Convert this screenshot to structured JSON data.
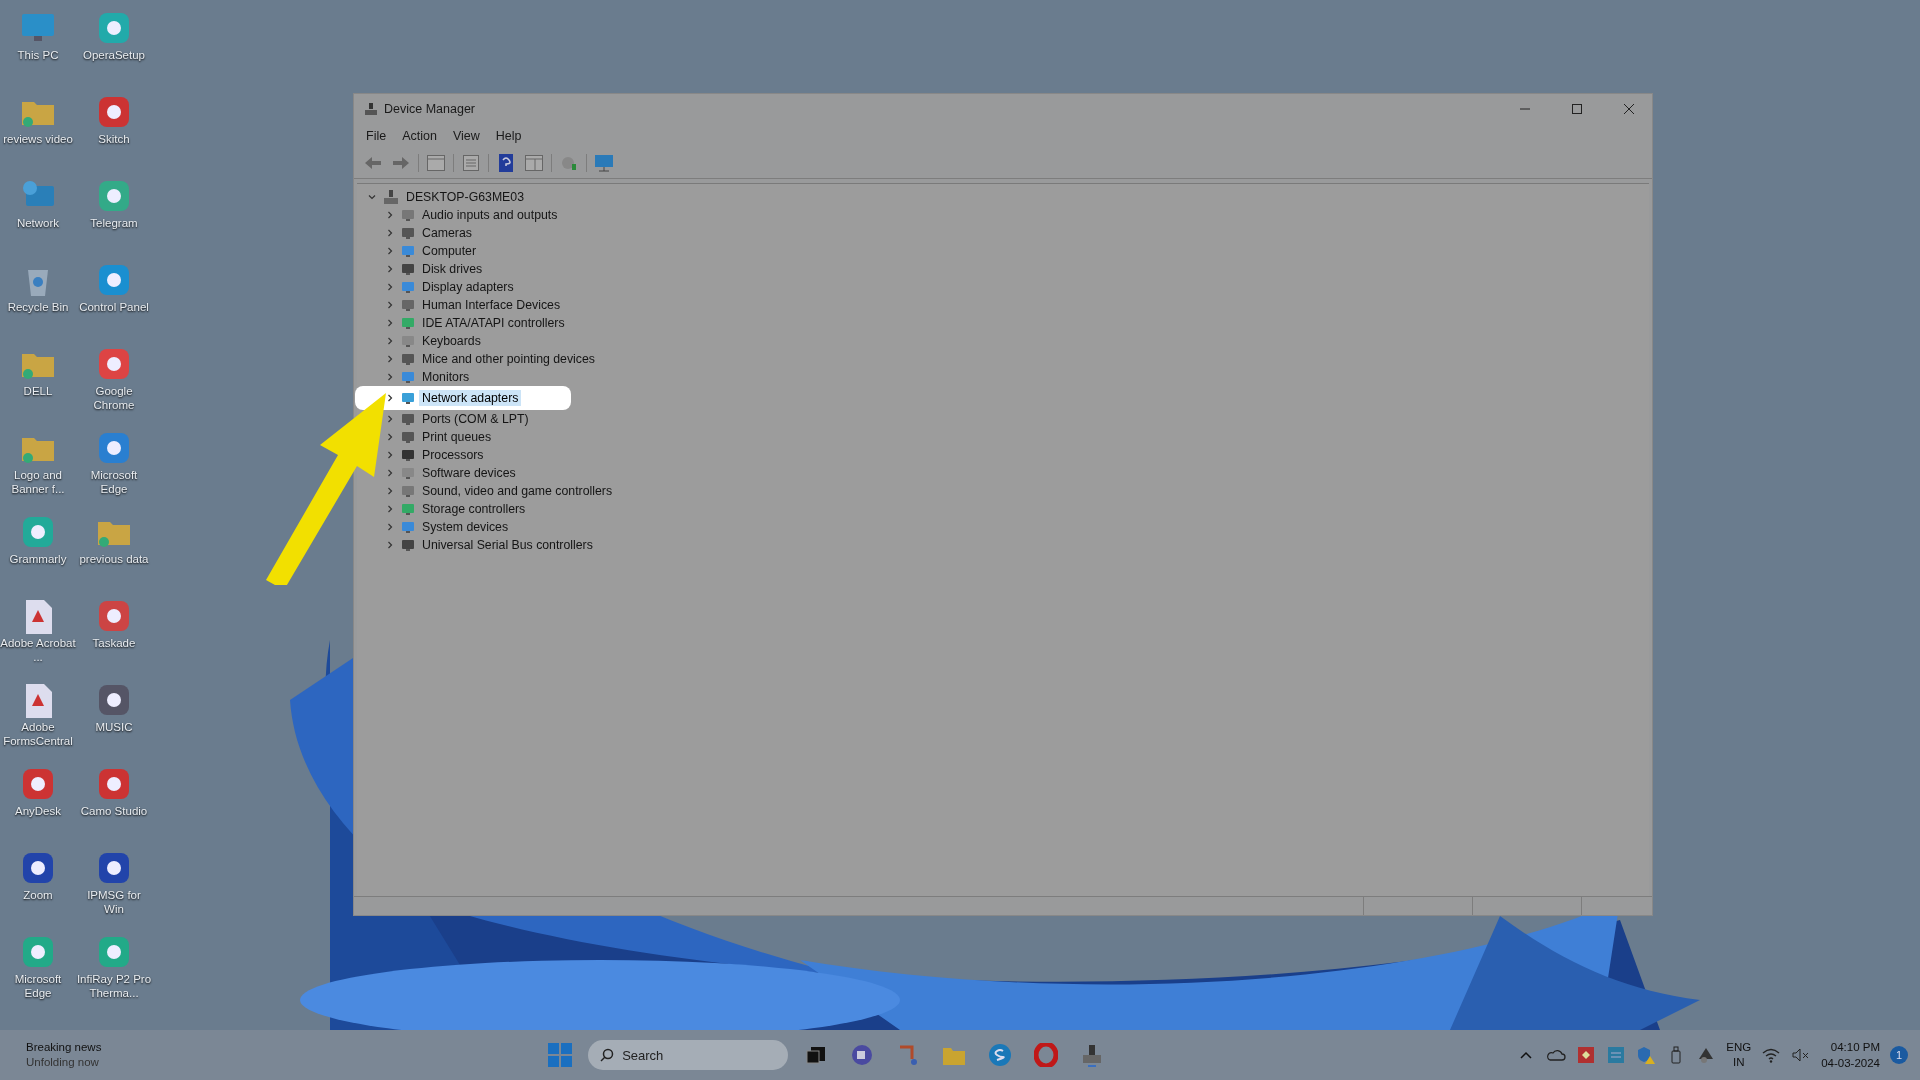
{
  "desktop_icons": [
    {
      "label": "This PC",
      "kind": "pc"
    },
    {
      "label": "reviews video",
      "kind": "folder"
    },
    {
      "label": "Network",
      "kind": "network"
    },
    {
      "label": "Recycle Bin",
      "kind": "bin"
    },
    {
      "label": "DELL",
      "kind": "folder"
    },
    {
      "label": "Logo and Banner f...",
      "kind": "folder"
    },
    {
      "label": "Grammarly",
      "kind": "app"
    },
    {
      "label": "Adobe Acrobat ...",
      "kind": "doc"
    },
    {
      "label": "Adobe FormsCentral",
      "kind": "doc"
    },
    {
      "label": "AnyDesk",
      "kind": "app"
    },
    {
      "label": "Zoom",
      "kind": "app"
    },
    {
      "label": "Microsoft Edge",
      "kind": "app"
    },
    {
      "label": "OperaSetup",
      "kind": "app"
    },
    {
      "label": "Skitch",
      "kind": "app"
    },
    {
      "label": "Telegram",
      "kind": "app"
    },
    {
      "label": "Control Panel",
      "kind": "app"
    },
    {
      "label": "Google Chrome",
      "kind": "app"
    },
    {
      "label": "Microsoft Edge",
      "kind": "app"
    },
    {
      "label": "previous data",
      "kind": "folder"
    },
    {
      "label": "Taskade",
      "kind": "app"
    },
    {
      "label": "MUSIC",
      "kind": "app"
    },
    {
      "label": "Camo Studio",
      "kind": "app"
    },
    {
      "label": "IPMSG for Win",
      "kind": "app"
    },
    {
      "label": "InfiRay P2 Pro Therma...",
      "kind": "app"
    }
  ],
  "window": {
    "title": "Device Manager",
    "menu": [
      "File",
      "Action",
      "View",
      "Help"
    ],
    "tree": {
      "label": "DESKTOP-G63ME03",
      "expanded": true,
      "children": [
        {
          "label": "Audio inputs and outputs",
          "expanded": false,
          "selected": false
        },
        {
          "label": "Cameras",
          "expanded": false,
          "selected": false
        },
        {
          "label": "Computer",
          "expanded": false,
          "selected": false
        },
        {
          "label": "Disk drives",
          "expanded": false,
          "selected": false
        },
        {
          "label": "Display adapters",
          "expanded": false,
          "selected": false
        },
        {
          "label": "Human Interface Devices",
          "expanded": false,
          "selected": false
        },
        {
          "label": "IDE ATA/ATAPI controllers",
          "expanded": false,
          "selected": false
        },
        {
          "label": "Keyboards",
          "expanded": false,
          "selected": false
        },
        {
          "label": "Mice and other pointing devices",
          "expanded": false,
          "selected": false
        },
        {
          "label": "Monitors",
          "expanded": false,
          "selected": false
        },
        {
          "label": "Network adapters",
          "expanded": false,
          "selected": true
        },
        {
          "label": "Ports (COM & LPT)",
          "expanded": false,
          "selected": false
        },
        {
          "label": "Print queues",
          "expanded": false,
          "selected": false
        },
        {
          "label": "Processors",
          "expanded": false,
          "selected": false
        },
        {
          "label": "Software devices",
          "expanded": false,
          "selected": false
        },
        {
          "label": "Sound, video and game controllers",
          "expanded": false,
          "selected": false
        },
        {
          "label": "Storage controllers",
          "expanded": false,
          "selected": false
        },
        {
          "label": "System devices",
          "expanded": false,
          "selected": false
        },
        {
          "label": "Universal Serial Bus controllers",
          "expanded": false,
          "selected": false
        }
      ]
    }
  },
  "taskbar": {
    "news_title": "Breaking news",
    "news_subtitle": "Unfolding now",
    "search": {
      "placeholder": "Search"
    },
    "language": "ENG",
    "region": "IN",
    "time": "04:10 PM",
    "date": "04-03-2024",
    "notifications": "1"
  }
}
